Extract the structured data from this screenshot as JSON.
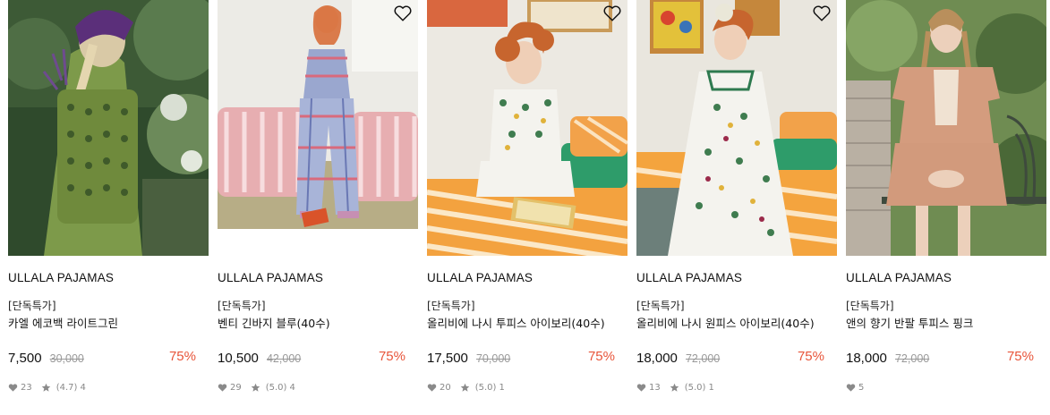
{
  "products": [
    {
      "brand": "ULLALA PAJAMAS",
      "tag": "[단독특가]",
      "name": "카엘 에코백 라이트그린",
      "price": "7,500",
      "original_price": "30,000",
      "discount": "75%",
      "likes": "23",
      "rating": "(4.7)",
      "reviews": "4",
      "image": "woman-with-purple-headscarf-and-green-tote",
      "wishlist": false
    },
    {
      "brand": "ULLALA PAJAMAS",
      "tag": "[단독특가]",
      "name": "벤티 긴바지 블루(40수)",
      "price": "10,500",
      "original_price": "42,000",
      "discount": "75%",
      "likes": "29",
      "rating": "(5.0)",
      "reviews": "4",
      "image": "woman-in-plaid-pajamas-pink-sofa",
      "wishlist": true
    },
    {
      "brand": "ULLALA PAJAMAS",
      "tag": "[단독특가]",
      "name": "올리비에 나시 투피스 아이보리(40수)",
      "price": "17,500",
      "original_price": "70,000",
      "discount": "75%",
      "likes": "20",
      "rating": "(5.0)",
      "reviews": "1",
      "image": "woman-in-floral-two-piece-on-bed",
      "wishlist": true
    },
    {
      "brand": "ULLALA PAJAMAS",
      "tag": "[단독특가]",
      "name": "올리비에 나시 원피스 아이보리(40수)",
      "price": "18,000",
      "original_price": "72,000",
      "discount": "75%",
      "likes": "13",
      "rating": "(5.0)",
      "reviews": "1",
      "image": "woman-in-floral-dress-on-bed",
      "wishlist": true
    },
    {
      "brand": "ULLALA PAJAMAS",
      "tag": "[단독특가]",
      "name": "앤의 향기 반팔 투피스 핑크",
      "price": "18,000",
      "original_price": "72,000",
      "discount": "75%",
      "likes": "5",
      "image": "woman-in-pink-dress-on-bench",
      "wishlist": false
    }
  ],
  "colors": {
    "discount": "#e8553a",
    "strike": "#999999",
    "meta": "#888888"
  }
}
